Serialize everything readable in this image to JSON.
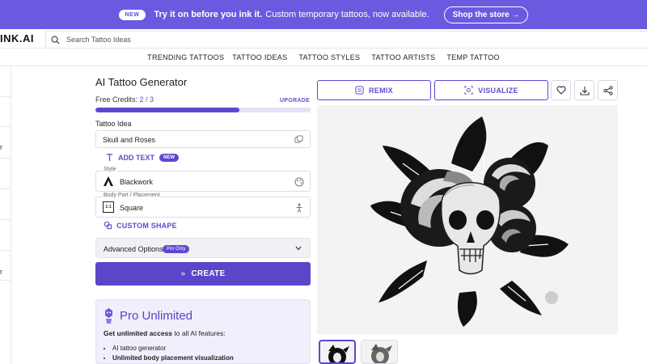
{
  "promo": {
    "badge": "NEW",
    "bold_text": "Try it on before you ink it.",
    "text": "Custom temporary tattoos, now available.",
    "shop_button": "Shop the store →"
  },
  "header": {
    "logo": "INK.AI",
    "search_placeholder": "Search Tattoo Ideas"
  },
  "nav": {
    "items": [
      "TRENDING TATTOOS",
      "TATTOO IDEAS",
      "TATTOO STYLES",
      "TATTOO ARTISTS",
      "TEMP TATTOO"
    ]
  },
  "form": {
    "title": "AI Tattoo Generator",
    "credits_label": "Free Credits:",
    "credits_value": "2 / 3",
    "credits_fraction": 0.67,
    "upgrade": "UPGRADE",
    "idea_label": "Tattoo Idea",
    "idea_value": "Skull and Roses",
    "add_text": "ADD TEXT",
    "add_text_badge": "NEW",
    "style_label": "Style",
    "style_value": "Blackwork",
    "placement_label": "Body Part / Placement",
    "placement_value": "Square",
    "placement_icon_text": "1:1",
    "custom_shape": "CUSTOM SHAPE",
    "advanced": "Advanced Options",
    "pro_only": "Pro Only",
    "create": "CREATE"
  },
  "pro_card": {
    "title": "Pro Unlimited",
    "subtitle_bold": "Get unlimited access",
    "subtitle_rest": "to all AI features:",
    "features": [
      "AI tattoo generator",
      "Unlimited body placement visualization"
    ]
  },
  "actions": {
    "remix": "REMIX",
    "visualize": "VISUALIZE"
  },
  "colors": {
    "accent": "#5b48d1",
    "banner": "#6a5ae0"
  }
}
